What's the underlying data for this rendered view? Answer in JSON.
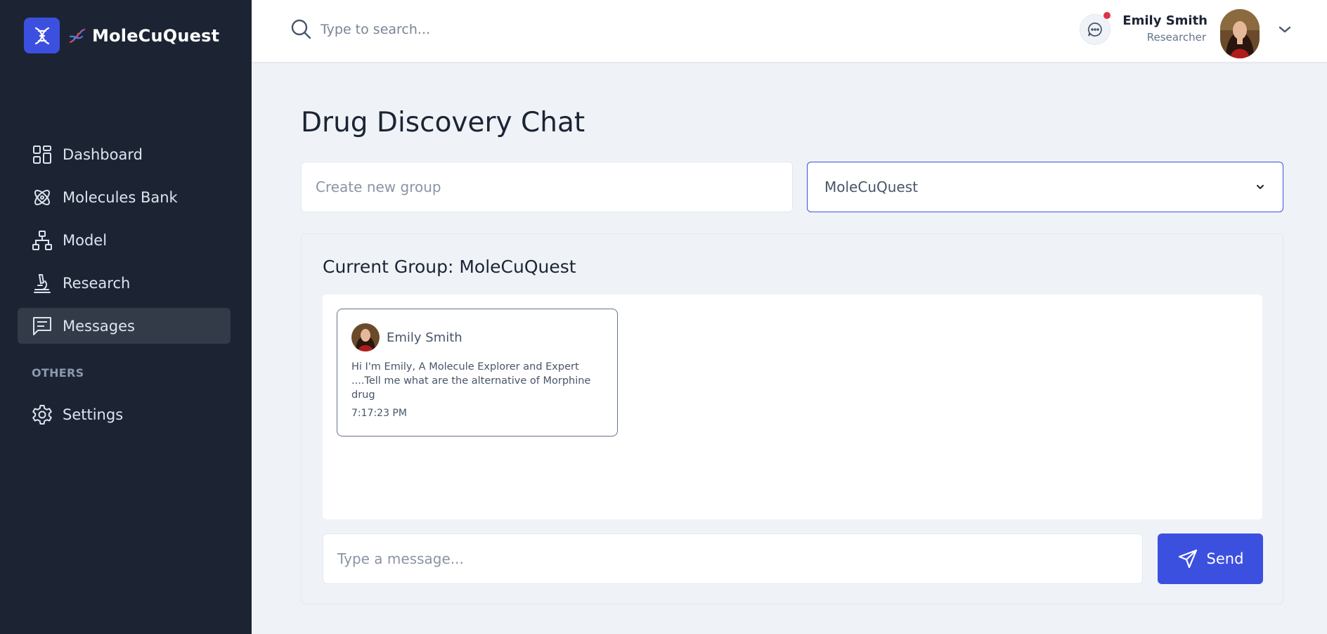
{
  "brand": {
    "name": "MoleCuQuest",
    "accent": "#3c50e0"
  },
  "sidebar": {
    "items": [
      {
        "label": "Dashboard",
        "icon": "grid-icon"
      },
      {
        "label": "Molecules Bank",
        "icon": "atom-icon"
      },
      {
        "label": "Model",
        "icon": "hierarchy-icon"
      },
      {
        "label": "Research",
        "icon": "microscope-icon"
      },
      {
        "label": "Messages",
        "icon": "message-icon",
        "active": true
      }
    ],
    "section_label": "OTHERS",
    "others": [
      {
        "label": "Settings",
        "icon": "gear-icon"
      }
    ]
  },
  "header": {
    "search_placeholder": "Type to search...",
    "user_name": "Emily Smith",
    "user_role": "Researcher"
  },
  "main": {
    "title": "Drug Discovery Chat",
    "group_placeholder": "Create new group",
    "group_selected": "MoleCuQuest",
    "current_group_label": "Current Group: MoleCuQuest",
    "messages": [
      {
        "sender": "Emily Smith",
        "text": "Hi I'm Emily, A Molecule Explorer and Expert ....Tell me what are the alternative of Morphine drug",
        "time": "7:17:23 PM"
      }
    ],
    "message_placeholder": "Type a message...",
    "send_label": "Send"
  }
}
